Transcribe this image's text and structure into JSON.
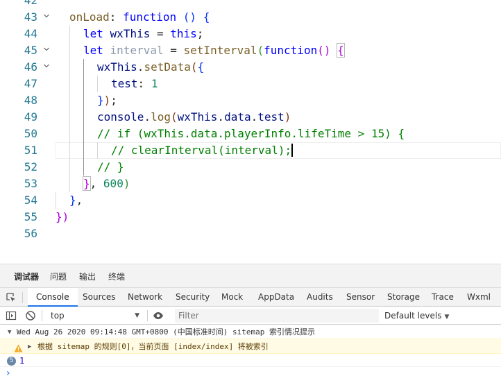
{
  "editor": {
    "lines": [
      {
        "num": "42",
        "fold": false
      },
      {
        "num": "43",
        "fold": true
      },
      {
        "num": "44",
        "fold": false
      },
      {
        "num": "45",
        "fold": true
      },
      {
        "num": "46",
        "fold": true
      },
      {
        "num": "47",
        "fold": false
      },
      {
        "num": "48",
        "fold": false
      },
      {
        "num": "49",
        "fold": false
      },
      {
        "num": "50",
        "fold": false
      },
      {
        "num": "51",
        "fold": false
      },
      {
        "num": "52",
        "fold": false
      },
      {
        "num": "53",
        "fold": false
      },
      {
        "num": "54",
        "fold": false
      },
      {
        "num": "55",
        "fold": false
      },
      {
        "num": "56",
        "fold": false
      }
    ],
    "t": {
      "onLoad": "onLoad",
      "colon": ":",
      "function": "function",
      "parens_open_brace": "() {",
      "let": "let",
      "wxThis": "wxThis",
      "eq": "=",
      "this": "this",
      "semi": ";",
      "interval": "interval",
      "setInterval": "setInterval",
      "lparen": "(",
      "parens": "()",
      "lbrace": "{",
      "dot": ".",
      "setData": "setData",
      "test": "test",
      "one": "1",
      "rbrace": "}",
      "rparen": ")",
      "console": "console",
      "log": "log",
      "data": "data",
      "comment1": "// if (wxThis.data.playerInfo.lifeTime > 15) {",
      "comment2": "// clearInterval(interval);",
      "comment3": "// }",
      "comma": ",",
      "six_hundred": "600"
    }
  },
  "devtools": {
    "panel_tabs": [
      "调试器",
      "问题",
      "输出",
      "终端"
    ],
    "tool_tabs": [
      "Console",
      "Sources",
      "Network",
      "Security",
      "Mock",
      "AppData",
      "Audits",
      "Sensor",
      "Storage",
      "Trace",
      "Wxml"
    ],
    "active_tool_tab": "Console",
    "context_select": "top",
    "filter_placeholder": "Filter",
    "levels_label": "Default levels",
    "messages": {
      "group_header": "Wed Aug 26 2020 09:14:48 GMT+0800 (中国标准时间) sitemap 索引情况提示",
      "warning": "根据 sitemap 的规则[0]，当前页面 [index/index] 将被索引",
      "log_count": "5",
      "log_value": "1"
    },
    "prompt_symbol": "›"
  },
  "icons": [
    "chevron-down-icon",
    "inspect-element-icon",
    "sidebar-toggle-icon",
    "clear-console-icon",
    "live-expression-eye-icon",
    "warning-icon",
    "expand-triangle-icon",
    "prompt-chevron-icon"
  ],
  "colors": {
    "accent": "#1a73e8",
    "line_number": "#237893",
    "keyword": "#0000ff",
    "comment": "#008000",
    "number": "#098658",
    "warning_bg": "#fffbe5"
  }
}
